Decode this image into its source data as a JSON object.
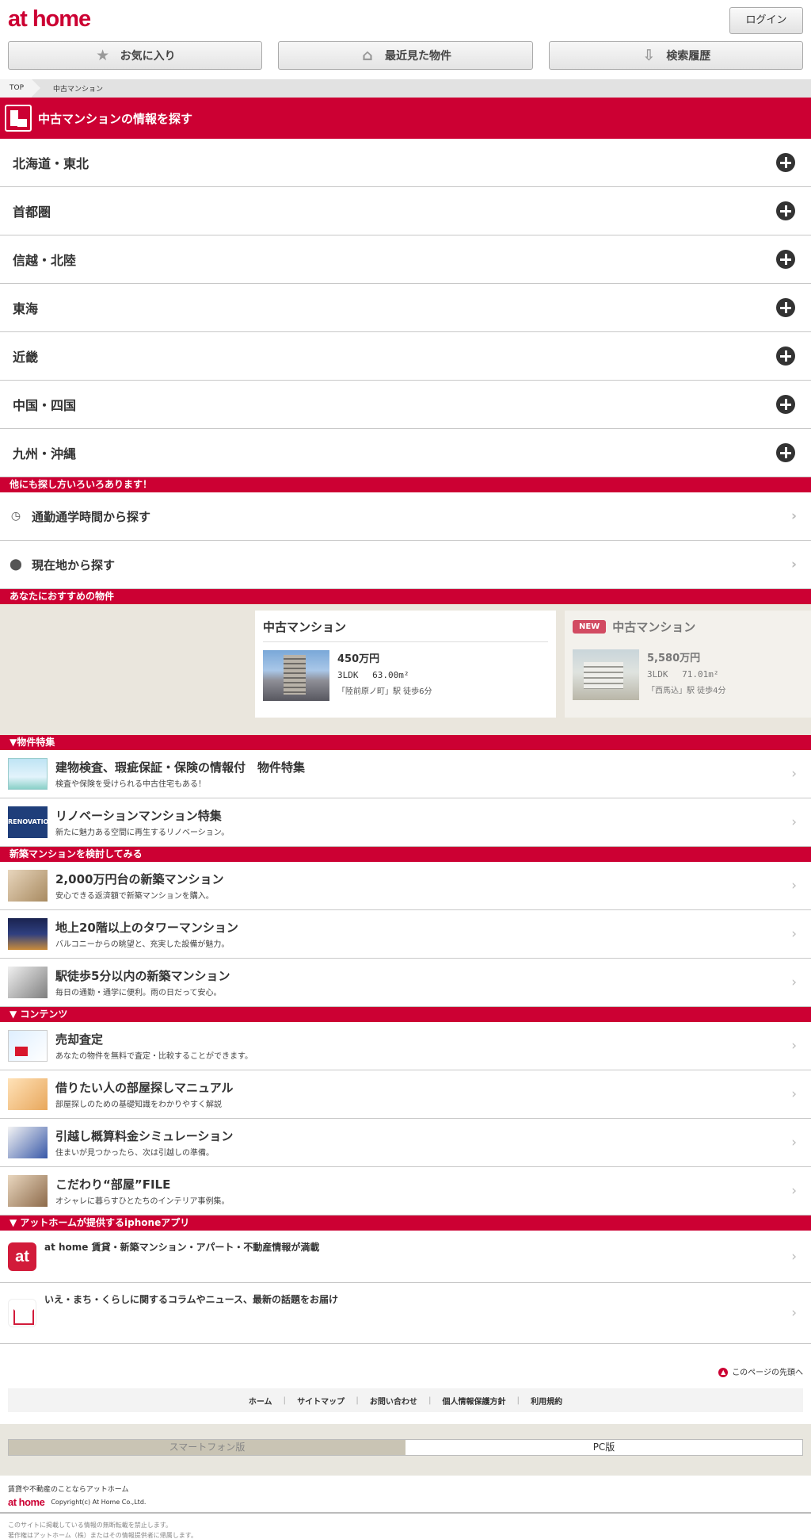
{
  "header": {
    "logo": "at home",
    "login_label": "ログイン"
  },
  "quicknav": [
    {
      "label": "お気に入り",
      "icon": "star-icon"
    },
    {
      "label": "最近見た物件",
      "icon": "house-icon"
    },
    {
      "label": "検索履歴",
      "icon": "download-icon"
    }
  ],
  "breadcrumb": {
    "top": "TOP",
    "current": "中古マンション"
  },
  "main_heading": "中古マンションの情報を探す",
  "regions": [
    "北海道・東北",
    "首都圏",
    "信越・北陸",
    "東海",
    "近畿",
    "中国・四国",
    "九州・沖縄"
  ],
  "other_search": {
    "heading": "他にも探し方いろいろあります！",
    "items": [
      {
        "label": "通勤通学時間から探す",
        "icon": "clock-icon"
      },
      {
        "label": "現在地から探す",
        "icon": "location-pin-icon"
      }
    ]
  },
  "recommended": {
    "heading": "あなたにおすすめの物件",
    "cards": [
      {
        "type": "中古マンション",
        "badge": "",
        "price": "450万円",
        "spec": "3LDK　 63.00m²",
        "station": "「陸前原ノ町」駅 徒歩6分"
      },
      {
        "type": "中古マンション",
        "badge": "NEW",
        "price": "5,580万円",
        "spec": "3LDK　 71.01m²",
        "station": "「西馬込」駅 徒歩4分"
      }
    ]
  },
  "features": {
    "heading": "▼物件特集",
    "items": [
      {
        "title": "建物検査、瑕疵保証・保険の情報付　物件特集",
        "sub": "検査や保険を受けられる中古住宅もある！"
      },
      {
        "title": "リノベーションマンション特集",
        "sub": "新たに魅力ある空間に再生するリノベーション。",
        "thumb_text": "RENOVATION"
      }
    ]
  },
  "new_mansion": {
    "heading": "新築マンションを検討してみる",
    "items": [
      {
        "title": "2,000万円台の新築マンション",
        "sub": "安心できる返済額で新築マンションを購入。"
      },
      {
        "title": "地上20階以上のタワーマンション",
        "sub": "バルコニーからの眺望と、充実した設備が魅力。"
      },
      {
        "title": "駅徒歩5分以内の新築マンション",
        "sub": "毎日の通勤・通学に便利。雨の日だって安心。"
      }
    ]
  },
  "contents": {
    "heading": "▼ コンテンツ",
    "items": [
      {
        "title": "売却査定",
        "sub": "あなたの物件を無料で査定・比較することができます。"
      },
      {
        "title": "借りたい人の部屋探しマニュアル",
        "sub": "部屋探しのための基礎知識をわかりやすく解説"
      },
      {
        "title": "引越し概算料金シミュレーション",
        "sub": "住まいが見つかったら、次は引越しの準備。"
      },
      {
        "title": "こだわり“部屋”FILE",
        "sub": "オシャレに暮らすひとたちのインテリア事例集。"
      }
    ]
  },
  "apps": {
    "heading": "▼ アットホームが提供するiphoneアプリ",
    "items": [
      {
        "icon_text": "at",
        "title": "at home 賃貸・新築マンション・アパート・不動産情報が満載"
      },
      {
        "title": "いえ・まち・くらしに関するコラムやニュース、最新の話題をお届け"
      }
    ]
  },
  "footer": {
    "page_top": "このページの先頭へ",
    "links": [
      "ホーム",
      "サイトマップ",
      "お問い合わせ",
      "個人情報保護方針",
      "利用規約"
    ],
    "version_sp": "スマートフォン版",
    "version_pc": "PC版",
    "tagline": "賃貸や不動産のことならアットホーム",
    "logo": "at home",
    "copyright": "Copyright(c) At Home Co.,Ltd.",
    "notice_1": "このサイトに掲載している情報の無断転載を禁止します。",
    "notice_2": "著作権はアットホーム（株）またはその情報提供者に帰属します。"
  },
  "colors": {
    "brand_red": "#cc0033",
    "separator": "#c8c8c8",
    "reco_bg": "#eae6dd"
  }
}
